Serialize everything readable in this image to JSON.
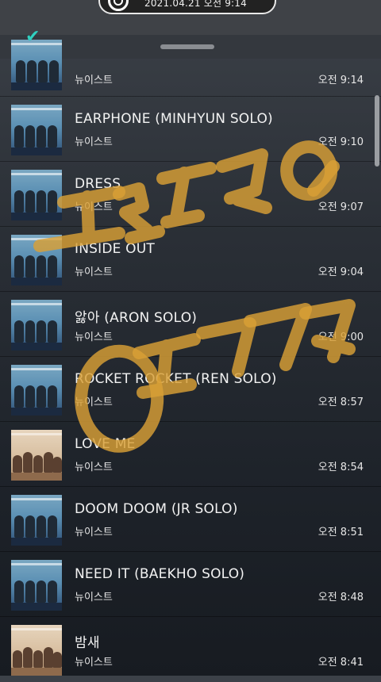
{
  "status": {
    "datetime": "2021.04.21 오전 9:14"
  },
  "songs": [
    {
      "title": "",
      "artist": "뉴이스트",
      "time": "오전 9:14",
      "cover": "blue"
    },
    {
      "title": "EARPHONE (MINHYUN SOLO)",
      "artist": "뉴이스트",
      "time": "오전 9:10",
      "cover": "blue"
    },
    {
      "title": "DRESS",
      "artist": "뉴이스트",
      "time": "오전 9:07",
      "cover": "blue"
    },
    {
      "title": "INSIDE OUT",
      "artist": "뉴이스트",
      "time": "오전 9:04",
      "cover": "blue"
    },
    {
      "title": "앓아 (ARON SOLO)",
      "artist": "뉴이스트",
      "time": "오전 9:00",
      "cover": "blue"
    },
    {
      "title": "ROCKET ROCKET (REN SOLO)",
      "artist": "뉴이스트",
      "time": "오전 8:57",
      "cover": "blue"
    },
    {
      "title": "LOVE ME",
      "artist": "뉴이스트",
      "time": "오전 8:54",
      "cover": "beige"
    },
    {
      "title": "DOOM DOOM (JR SOLO)",
      "artist": "뉴이스트",
      "time": "오전 8:51",
      "cover": "blue"
    },
    {
      "title": "NEED IT (BAEKHO SOLO)",
      "artist": "뉴이스트",
      "time": "오전 8:48",
      "cover": "blue"
    },
    {
      "title": "밤새",
      "artist": "뉴이스트",
      "time": "오전 8:41",
      "cover": "beige"
    }
  ],
  "colors": {
    "overlay_marker": "#d9a036",
    "check": "#30d0c0"
  }
}
